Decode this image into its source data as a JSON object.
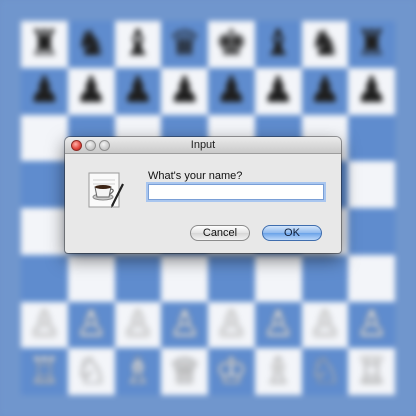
{
  "dialog": {
    "title": "Input",
    "prompt": "What's your name?",
    "input_value": "",
    "cancel_label": "Cancel",
    "ok_label": "OK"
  },
  "board": {
    "colors": {
      "light": "#f3f5f9",
      "dark": "#5f8cce"
    },
    "ranks": [
      [
        "♜",
        "♞",
        "♝",
        "♛",
        "♚",
        "♝",
        "♞",
        "♜"
      ],
      [
        "♟",
        "♟",
        "♟",
        "♟",
        "♟",
        "♟",
        "♟",
        "♟"
      ],
      [
        "",
        "",
        "",
        "",
        "",
        "",
        "",
        ""
      ],
      [
        "",
        "",
        "",
        "",
        "",
        "",
        "",
        ""
      ],
      [
        "",
        "",
        "",
        "",
        "",
        "",
        "",
        ""
      ],
      [
        "",
        "",
        "",
        "",
        "",
        "",
        "",
        ""
      ],
      [
        "♙",
        "♙",
        "♙",
        "♙",
        "♙",
        "♙",
        "♙",
        "♙"
      ],
      [
        "♖",
        "♘",
        "♗",
        "♕",
        "♔",
        "♗",
        "♘",
        "♖"
      ]
    ],
    "piece_colors": [
      "black",
      "black",
      "",
      "",
      "",
      "",
      "white",
      "white"
    ]
  }
}
